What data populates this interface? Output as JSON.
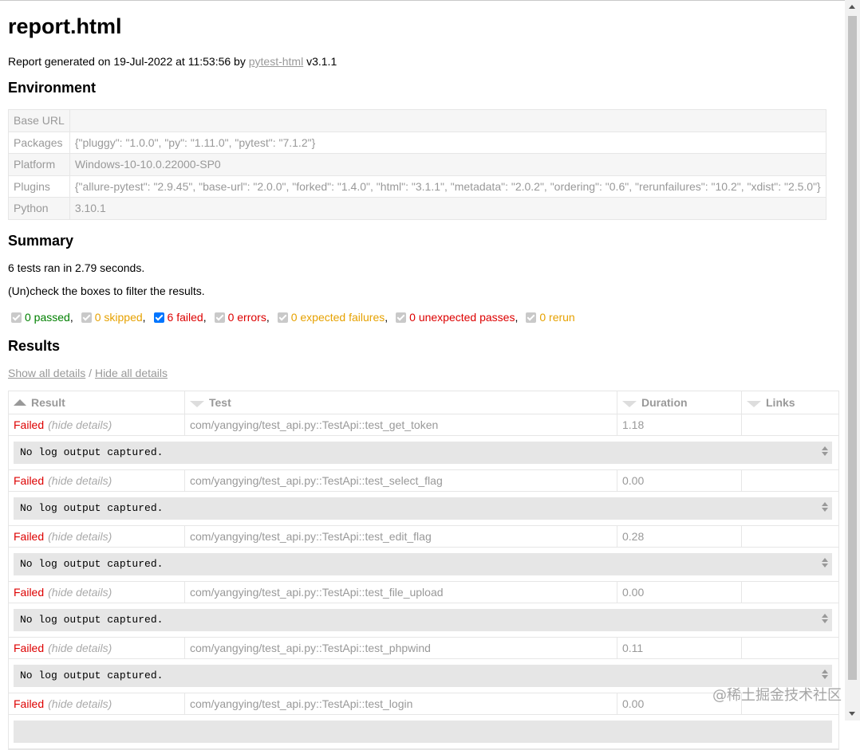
{
  "title": "report.html",
  "generated": {
    "prefix": "Report generated on 19-Jul-2022 at 11:53:56 by ",
    "link": "pytest-html",
    "suffix": " v3.1.1"
  },
  "environment": {
    "heading": "Environment",
    "rows": [
      {
        "key": "Base URL",
        "value": ""
      },
      {
        "key": "Packages",
        "value": "{\"pluggy\": \"1.0.0\", \"py\": \"1.11.0\", \"pytest\": \"7.1.2\"}"
      },
      {
        "key": "Platform",
        "value": "Windows-10-10.0.22000-SP0"
      },
      {
        "key": "Plugins",
        "value": "{\"allure-pytest\": \"2.9.45\", \"base-url\": \"2.0.0\", \"forked\": \"1.4.0\", \"html\": \"3.1.1\", \"metadata\": \"2.0.2\", \"ordering\": \"0.6\", \"rerunfailures\": \"10.2\", \"xdist\": \"2.5.0\"}"
      },
      {
        "key": "Python",
        "value": "3.10.1"
      }
    ]
  },
  "summary": {
    "heading": "Summary",
    "ran": "6 tests ran in 2.79 seconds.",
    "hint": "(Un)check the boxes to filter the results.",
    "filters": [
      {
        "label": "0 passed",
        "sep": ",",
        "checked": false
      },
      {
        "label": "0 skipped",
        "sep": ",",
        "checked": false
      },
      {
        "label": "6 failed",
        "sep": ",",
        "checked": true
      },
      {
        "label": "0 errors",
        "sep": ",",
        "checked": false
      },
      {
        "label": "0 expected failures",
        "sep": ",",
        "checked": false
      },
      {
        "label": "0 unexpected passes",
        "sep": ",",
        "checked": false
      },
      {
        "label": "0 rerun",
        "sep": "",
        "checked": false
      }
    ]
  },
  "results": {
    "heading": "Results",
    "show_all": "Show all details",
    "divider": " / ",
    "hide_all": "Hide all details",
    "columns": [
      "Result",
      "Test",
      "Duration",
      "Links"
    ],
    "rows": [
      {
        "status": "Failed",
        "toggle": "(hide details)",
        "test": "com/yangying/test_api.py::TestApi::test_get_token",
        "duration": "1.18",
        "log": "No log output captured."
      },
      {
        "status": "Failed",
        "toggle": "(hide details)",
        "test": "com/yangying/test_api.py::TestApi::test_select_flag",
        "duration": "0.00",
        "log": "No log output captured."
      },
      {
        "status": "Failed",
        "toggle": "(hide details)",
        "test": "com/yangying/test_api.py::TestApi::test_edit_flag",
        "duration": "0.28",
        "log": "No log output captured."
      },
      {
        "status": "Failed",
        "toggle": "(hide details)",
        "test": "com/yangying/test_api.py::TestApi::test_file_upload",
        "duration": "0.00",
        "log": "No log output captured."
      },
      {
        "status": "Failed",
        "toggle": "(hide details)",
        "test": "com/yangying/test_api.py::TestApi::test_phpwind",
        "duration": "0.11",
        "log": "No log output captured."
      },
      {
        "status": "Failed",
        "toggle": "(hide details)",
        "test": "com/yangying/test_api.py::TestApi::test_login",
        "duration": "0.00",
        "log": ""
      }
    ]
  },
  "watermark": "@稀土掘金技术社区"
}
